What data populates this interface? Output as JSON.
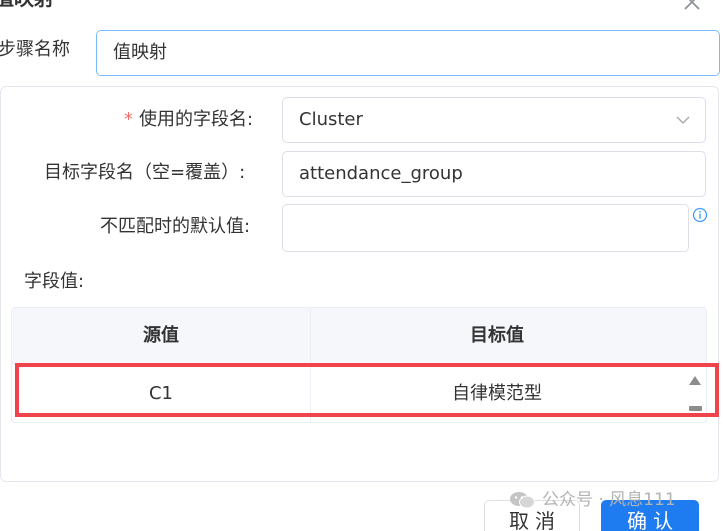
{
  "dialog": {
    "title": "值映射",
    "close_icon": "close-icon"
  },
  "step": {
    "label": "步骤名称",
    "value": "值映射"
  },
  "form": {
    "field_name": {
      "required_mark": "*",
      "label": "使用的字段名:",
      "value": "Cluster"
    },
    "target_field": {
      "label": "目标字段名（空=覆盖）:",
      "value": "attendance_group"
    },
    "default_value": {
      "label": "不匹配时的默认值:",
      "value": ""
    },
    "field_values_label": "字段值:"
  },
  "mapping_table": {
    "columns": [
      "源值",
      "目标值"
    ],
    "rows": [
      {
        "source": "C1",
        "target": "自律模范型"
      }
    ]
  },
  "buttons": {
    "cancel": "取消",
    "confirm": "确认"
  },
  "watermark": {
    "text": "公众号 · 风息111"
  },
  "colors": {
    "accent": "#1e7bf0",
    "highlight": "#f0434c",
    "required": "#f56c6c",
    "focus_border": "#79bbff"
  }
}
